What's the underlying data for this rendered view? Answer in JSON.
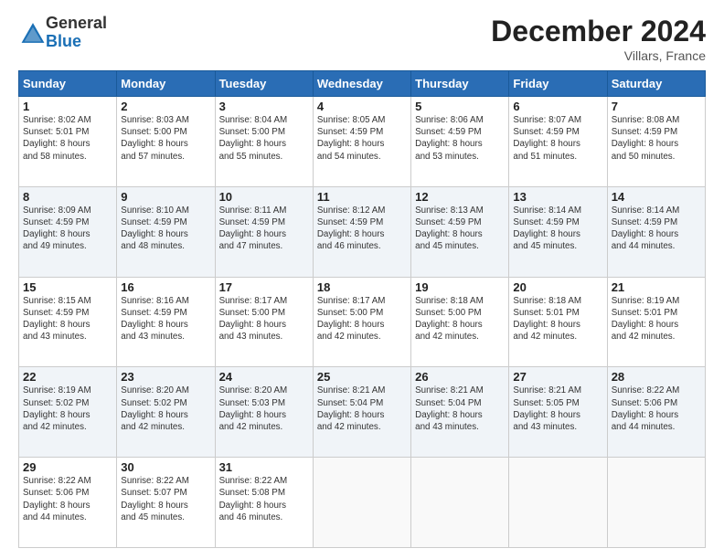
{
  "header": {
    "logo_general": "General",
    "logo_blue": "Blue",
    "title": "December 2024",
    "location": "Villars, France"
  },
  "days_of_week": [
    "Sunday",
    "Monday",
    "Tuesday",
    "Wednesday",
    "Thursday",
    "Friday",
    "Saturday"
  ],
  "weeks": [
    [
      {
        "day": "1",
        "sunrise": "8:02 AM",
        "sunset": "5:01 PM",
        "daylight": "8 hours and 58 minutes."
      },
      {
        "day": "2",
        "sunrise": "8:03 AM",
        "sunset": "5:00 PM",
        "daylight": "8 hours and 57 minutes."
      },
      {
        "day": "3",
        "sunrise": "8:04 AM",
        "sunset": "5:00 PM",
        "daylight": "8 hours and 55 minutes."
      },
      {
        "day": "4",
        "sunrise": "8:05 AM",
        "sunset": "4:59 PM",
        "daylight": "8 hours and 54 minutes."
      },
      {
        "day": "5",
        "sunrise": "8:06 AM",
        "sunset": "4:59 PM",
        "daylight": "8 hours and 53 minutes."
      },
      {
        "day": "6",
        "sunrise": "8:07 AM",
        "sunset": "4:59 PM",
        "daylight": "8 hours and 51 minutes."
      },
      {
        "day": "7",
        "sunrise": "8:08 AM",
        "sunset": "4:59 PM",
        "daylight": "8 hours and 50 minutes."
      }
    ],
    [
      {
        "day": "8",
        "sunrise": "8:09 AM",
        "sunset": "4:59 PM",
        "daylight": "8 hours and 49 minutes."
      },
      {
        "day": "9",
        "sunrise": "8:10 AM",
        "sunset": "4:59 PM",
        "daylight": "8 hours and 48 minutes."
      },
      {
        "day": "10",
        "sunrise": "8:11 AM",
        "sunset": "4:59 PM",
        "daylight": "8 hours and 47 minutes."
      },
      {
        "day": "11",
        "sunrise": "8:12 AM",
        "sunset": "4:59 PM",
        "daylight": "8 hours and 46 minutes."
      },
      {
        "day": "12",
        "sunrise": "8:13 AM",
        "sunset": "4:59 PM",
        "daylight": "8 hours and 45 minutes."
      },
      {
        "day": "13",
        "sunrise": "8:14 AM",
        "sunset": "4:59 PM",
        "daylight": "8 hours and 45 minutes."
      },
      {
        "day": "14",
        "sunrise": "8:14 AM",
        "sunset": "4:59 PM",
        "daylight": "8 hours and 44 minutes."
      }
    ],
    [
      {
        "day": "15",
        "sunrise": "8:15 AM",
        "sunset": "4:59 PM",
        "daylight": "8 hours and 43 minutes."
      },
      {
        "day": "16",
        "sunrise": "8:16 AM",
        "sunset": "4:59 PM",
        "daylight": "8 hours and 43 minutes."
      },
      {
        "day": "17",
        "sunrise": "8:17 AM",
        "sunset": "5:00 PM",
        "daylight": "8 hours and 43 minutes."
      },
      {
        "day": "18",
        "sunrise": "8:17 AM",
        "sunset": "5:00 PM",
        "daylight": "8 hours and 42 minutes."
      },
      {
        "day": "19",
        "sunrise": "8:18 AM",
        "sunset": "5:00 PM",
        "daylight": "8 hours and 42 minutes."
      },
      {
        "day": "20",
        "sunrise": "8:18 AM",
        "sunset": "5:01 PM",
        "daylight": "8 hours and 42 minutes."
      },
      {
        "day": "21",
        "sunrise": "8:19 AM",
        "sunset": "5:01 PM",
        "daylight": "8 hours and 42 minutes."
      }
    ],
    [
      {
        "day": "22",
        "sunrise": "8:19 AM",
        "sunset": "5:02 PM",
        "daylight": "8 hours and 42 minutes."
      },
      {
        "day": "23",
        "sunrise": "8:20 AM",
        "sunset": "5:02 PM",
        "daylight": "8 hours and 42 minutes."
      },
      {
        "day": "24",
        "sunrise": "8:20 AM",
        "sunset": "5:03 PM",
        "daylight": "8 hours and 42 minutes."
      },
      {
        "day": "25",
        "sunrise": "8:21 AM",
        "sunset": "5:04 PM",
        "daylight": "8 hours and 42 minutes."
      },
      {
        "day": "26",
        "sunrise": "8:21 AM",
        "sunset": "5:04 PM",
        "daylight": "8 hours and 43 minutes."
      },
      {
        "day": "27",
        "sunrise": "8:21 AM",
        "sunset": "5:05 PM",
        "daylight": "8 hours and 43 minutes."
      },
      {
        "day": "28",
        "sunrise": "8:22 AM",
        "sunset": "5:06 PM",
        "daylight": "8 hours and 44 minutes."
      }
    ],
    [
      {
        "day": "29",
        "sunrise": "8:22 AM",
        "sunset": "5:06 PM",
        "daylight": "8 hours and 44 minutes."
      },
      {
        "day": "30",
        "sunrise": "8:22 AM",
        "sunset": "5:07 PM",
        "daylight": "8 hours and 45 minutes."
      },
      {
        "day": "31",
        "sunrise": "8:22 AM",
        "sunset": "5:08 PM",
        "daylight": "8 hours and 46 minutes."
      },
      null,
      null,
      null,
      null
    ]
  ],
  "labels": {
    "sunrise": "Sunrise:",
    "sunset": "Sunset:",
    "daylight": "Daylight hours"
  }
}
